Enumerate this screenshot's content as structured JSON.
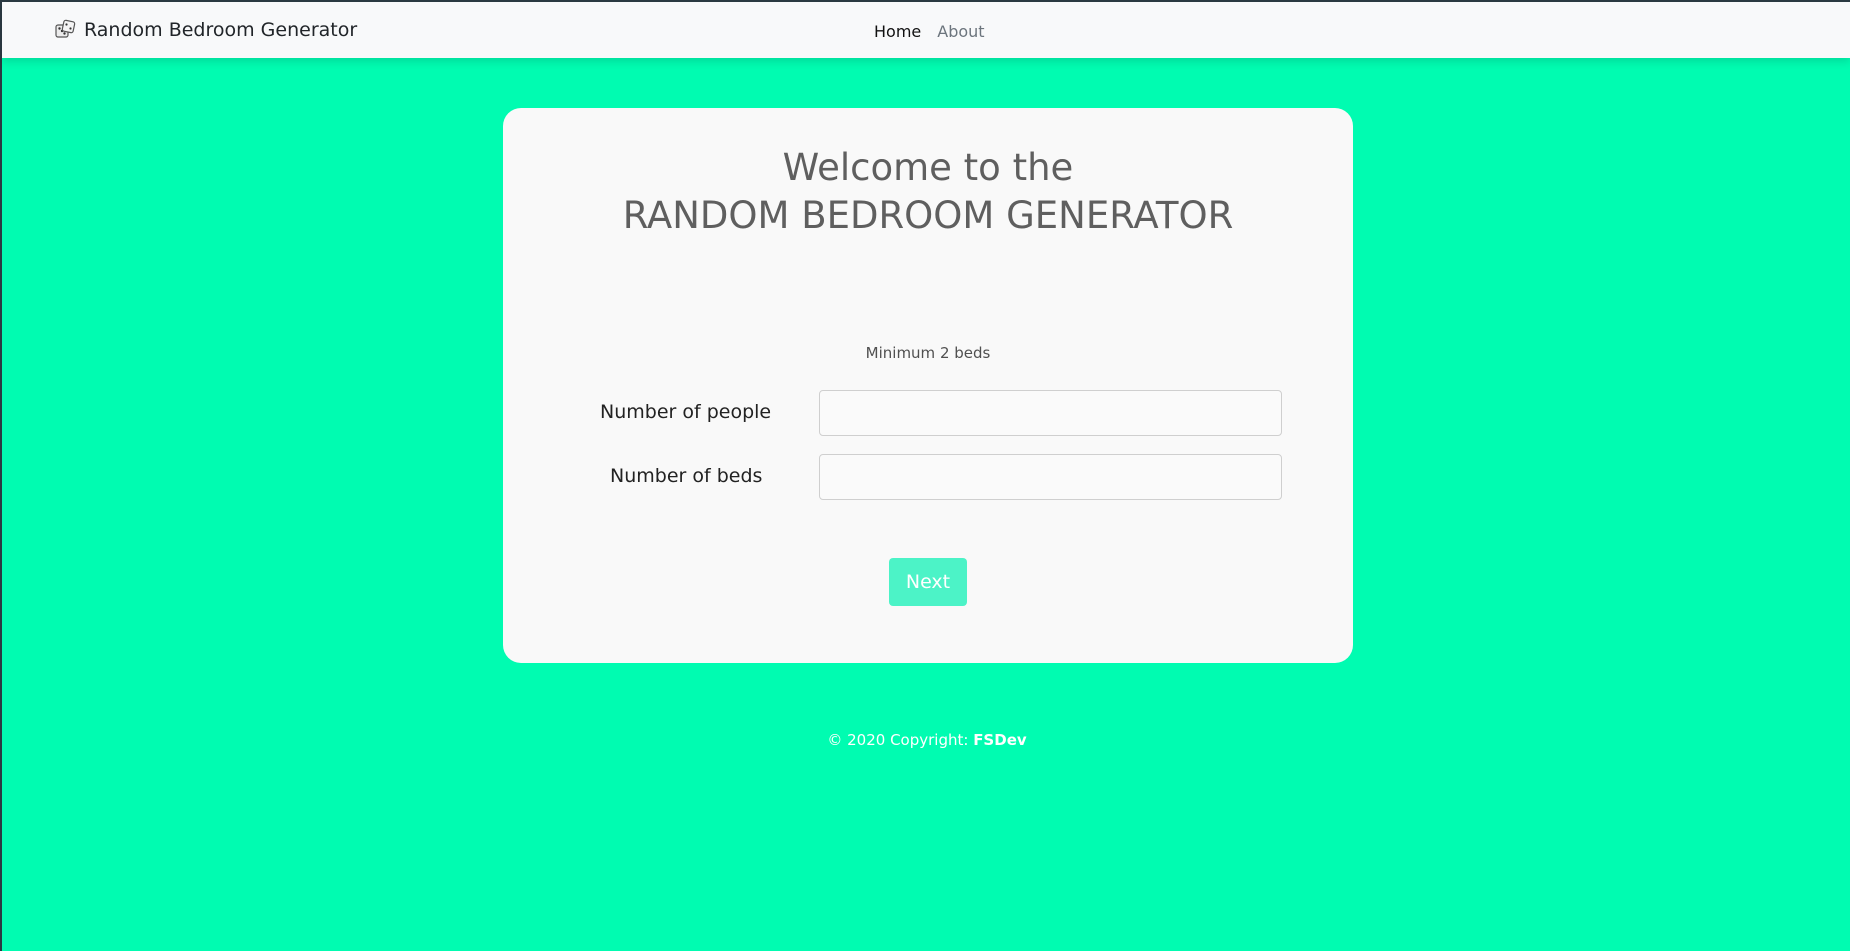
{
  "navbar": {
    "brand_icon": "dice-icon",
    "brand_text": "Random Bedroom Generator",
    "links": [
      {
        "label": "Home",
        "active": true
      },
      {
        "label": "About",
        "active": false
      }
    ]
  },
  "card": {
    "title_line1": "Welcome to the",
    "title_line2": "RANDOM BEDROOM GENERATOR",
    "hint": "Minimum 2 beds",
    "fields": [
      {
        "label": "Number of people",
        "value": "",
        "placeholder": ""
      },
      {
        "label": "Number of beds",
        "value": "",
        "placeholder": ""
      }
    ],
    "next_label": "Next"
  },
  "footer": {
    "copyright": "© 2020 Copyright: ",
    "author": "FSDev"
  },
  "colors": {
    "background": "#00fcb1",
    "card": "#f9f9f9",
    "button": "#4cf3c7",
    "navbar": "#f8f9fa"
  }
}
